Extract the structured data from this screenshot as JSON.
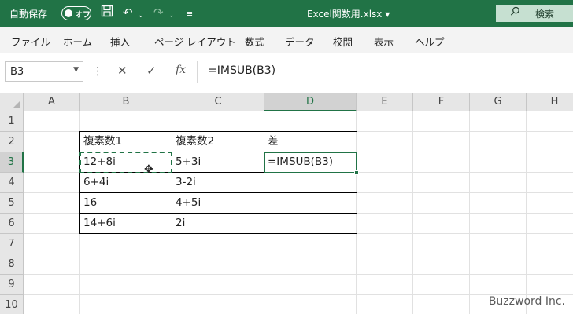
{
  "titlebar": {
    "autosave_label": "自動保存",
    "toggle_state": "オフ",
    "doc_title": "Excel関数用.xlsx ▾",
    "search_label": "検索"
  },
  "menu": [
    "ファイル",
    "ホーム",
    "挿入",
    "ページ レイアウト",
    "数式",
    "データ",
    "校閲",
    "表示",
    "ヘルプ"
  ],
  "formula_bar": {
    "name_box": "B3",
    "formula": "=IMSUB(B3)"
  },
  "columns": [
    "A",
    "B",
    "C",
    "D",
    "E",
    "F",
    "G",
    "H"
  ],
  "active_column": "D",
  "rows": [
    "1",
    "2",
    "3",
    "4",
    "5",
    "6",
    "7",
    "8",
    "9",
    "10"
  ],
  "active_row": "3",
  "table": {
    "headers": [
      "複素数1",
      "複素数2",
      "差"
    ],
    "rows": [
      [
        "12+8i",
        "5+3i",
        "=IMSUB(B3)"
      ],
      [
        "6+4i",
        "3-2i",
        ""
      ],
      [
        "16",
        "4+5i",
        ""
      ],
      [
        "14+6i",
        "2i",
        ""
      ]
    ]
  },
  "watermark": "Buzzword Inc.",
  "colors": {
    "accent": "#217346"
  }
}
